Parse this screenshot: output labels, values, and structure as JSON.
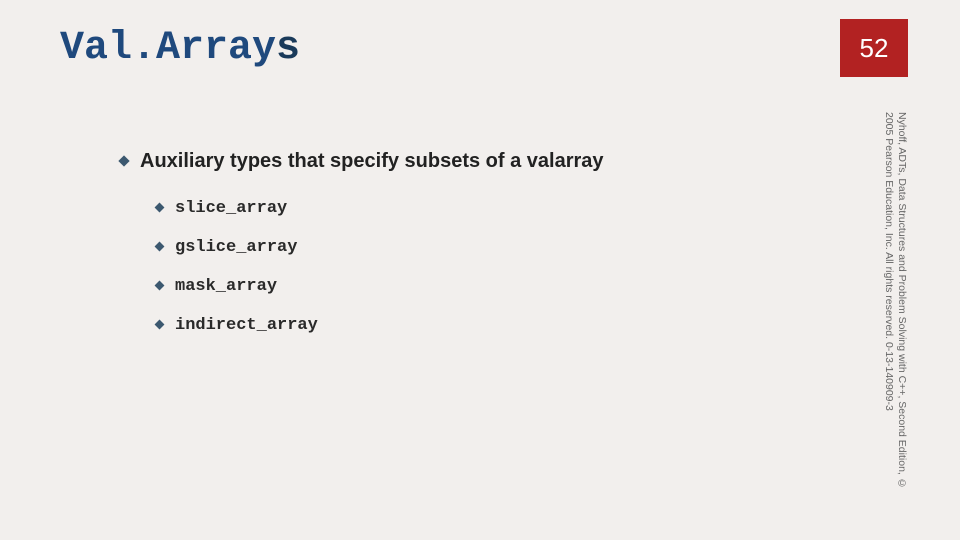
{
  "header": {
    "title_main": "Val.Array",
    "title_suffix": "s",
    "page_number": "52"
  },
  "content": {
    "heading": "Auxiliary types that specify subsets of a valarray",
    "items": [
      "slice_array",
      "gslice_array",
      "mask_array",
      "indirect_array"
    ]
  },
  "citation": "Nyhoff, ADTs, Data Structures and Problem Solving with C++, Second Edition, © 2005 Pearson Education, Inc. All rights reserved. 0-13-140909-3"
}
